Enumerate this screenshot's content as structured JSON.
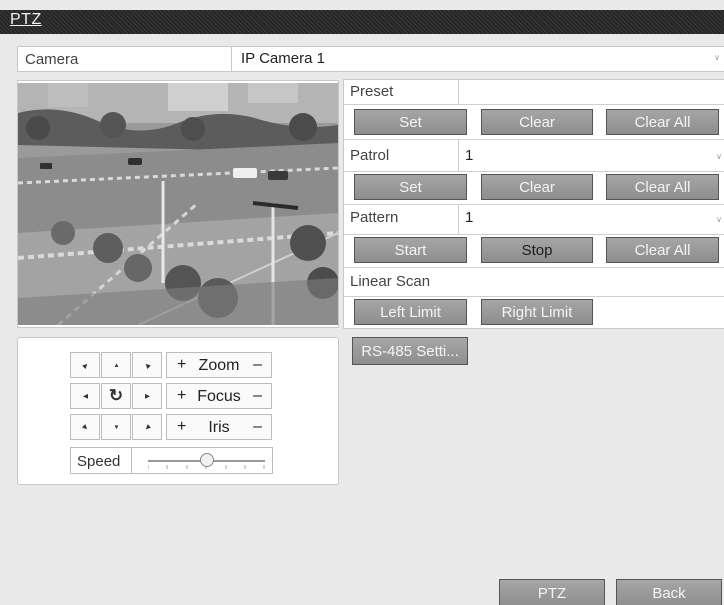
{
  "window": {
    "title": "PTZ"
  },
  "camera": {
    "label": "Camera",
    "value": "IP Camera 1"
  },
  "controls": {
    "zoom": {
      "plus": "+",
      "name": "Zoom",
      "minus": "–"
    },
    "focus": {
      "plus": "+",
      "name": "Focus",
      "minus": "–"
    },
    "iris": {
      "plus": "+",
      "name": "Iris",
      "minus": "–"
    },
    "speed_label": "Speed",
    "speed_level": 0.5
  },
  "preset": {
    "label": "Preset",
    "value": "",
    "set": "Set",
    "clear": "Clear",
    "clear_all": "Clear All"
  },
  "patrol": {
    "label": "Patrol",
    "value": "1",
    "set": "Set",
    "clear": "Clear",
    "clear_all": "Clear All"
  },
  "pattern": {
    "label": "Pattern",
    "value": "1",
    "start": "Start",
    "stop": "Stop",
    "clear_all": "Clear All"
  },
  "linear_scan": {
    "label": "Linear Scan",
    "left": "Left Limit",
    "right": "Right Limit"
  },
  "rs485_button": "RS-485 Setti...",
  "footer": {
    "ptz": "PTZ",
    "back": "Back"
  },
  "icons": {
    "arrow_up": "▲",
    "arrow_down": "▼",
    "arrow_left": "◀",
    "arrow_right": "▶",
    "auto_pan": "↻",
    "dropdown": "∨"
  }
}
